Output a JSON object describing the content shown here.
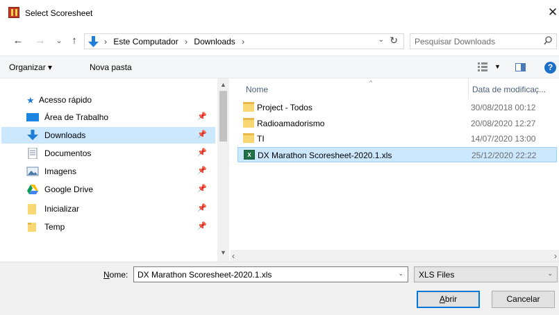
{
  "window": {
    "title": "Select Scoresheet"
  },
  "navigation": {
    "back_glyph": "←",
    "forward_glyph": "→",
    "recent_glyph": "⌄",
    "up_glyph": "↑",
    "breadcrumbs": [
      "Este Computador",
      "Downloads"
    ],
    "separator": "›",
    "search_placeholder": "Pesquisar Downloads"
  },
  "commands": {
    "organize": "Organizar ▾",
    "new_folder": "Nova pasta"
  },
  "sidebar": {
    "quick_access": "Acesso rápido",
    "items": [
      {
        "label": "Área de Trabalho",
        "icon": "desktop-icon"
      },
      {
        "label": "Downloads",
        "icon": "downloads-icon",
        "selected": true
      },
      {
        "label": "Documentos",
        "icon": "documents-icon"
      },
      {
        "label": "Imagens",
        "icon": "pictures-icon"
      },
      {
        "label": "Google Drive",
        "icon": "google-drive-icon"
      },
      {
        "label": "Inicializar",
        "icon": "folder-icon"
      },
      {
        "label": "Temp",
        "icon": "folder-icon"
      }
    ]
  },
  "file_list": {
    "columns": {
      "name": "Nome",
      "date": "Data de modificaç..."
    },
    "rows": [
      {
        "name": "Project - Todos",
        "date": "30/08/2018 00:12",
        "type": "folder"
      },
      {
        "name": "Radioamadorismo",
        "date": "20/08/2020 12:27",
        "type": "folder"
      },
      {
        "name": "TI",
        "date": "14/07/2020 13:00",
        "type": "folder"
      },
      {
        "name": "DX Marathon Scoresheet-2020.1.xls",
        "date": "25/12/2020 22:22",
        "type": "xls",
        "selected": true
      }
    ]
  },
  "footer": {
    "filename_label": "Nome:",
    "filename_value": "DX Marathon Scoresheet-2020.1.xls",
    "filetype": "XLS Files",
    "open_button": "Abrir",
    "cancel_button": "Cancelar"
  },
  "colors": {
    "accent": "#0078d7",
    "selection": "#cce8ff",
    "selection_border": "#99d1ff",
    "folder": "#f8d775"
  }
}
